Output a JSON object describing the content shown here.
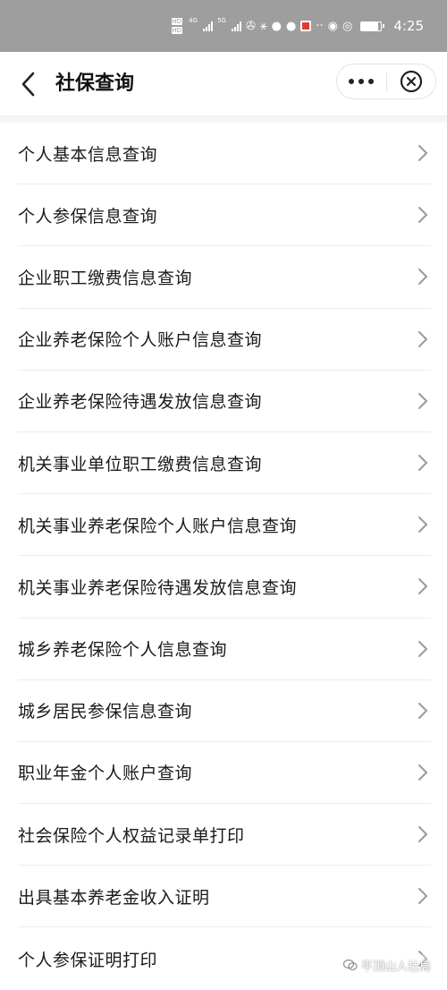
{
  "status_bar": {
    "hd_tag_1": "HD",
    "hd_tag_2": "HD",
    "network_1": "4G",
    "network_2": "5G",
    "battery_level": 0.85,
    "time": "4:25"
  },
  "nav": {
    "title": "社保查询",
    "more_label": "•••"
  },
  "menu": {
    "items": [
      {
        "label": "个人基本信息查询"
      },
      {
        "label": "个人参保信息查询"
      },
      {
        "label": "企业职工缴费信息查询"
      },
      {
        "label": "企业养老保险个人账户信息查询"
      },
      {
        "label": "企业养老保险待遇发放信息查询"
      },
      {
        "label": "机关事业单位职工缴费信息查询"
      },
      {
        "label": "机关事业养老保险个人账户信息查询"
      },
      {
        "label": "机关事业养老保险待遇发放信息查询"
      },
      {
        "label": "城乡养老保险个人信息查询"
      },
      {
        "label": "城乡居民参保信息查询"
      },
      {
        "label": "职业年金个人账户查询"
      },
      {
        "label": "社会保险个人权益记录单打印"
      },
      {
        "label": "出具基本养老金收入证明"
      },
      {
        "label": "个人参保证明打印"
      }
    ]
  },
  "watermark": {
    "text": "平顶山人社局"
  },
  "icons": {
    "back": "back-arrow-icon",
    "more": "more-dots-icon",
    "close": "close-circle-icon",
    "chevron": "chevron-right-icon",
    "watermark_logo": "wechat-logo-icon"
  }
}
